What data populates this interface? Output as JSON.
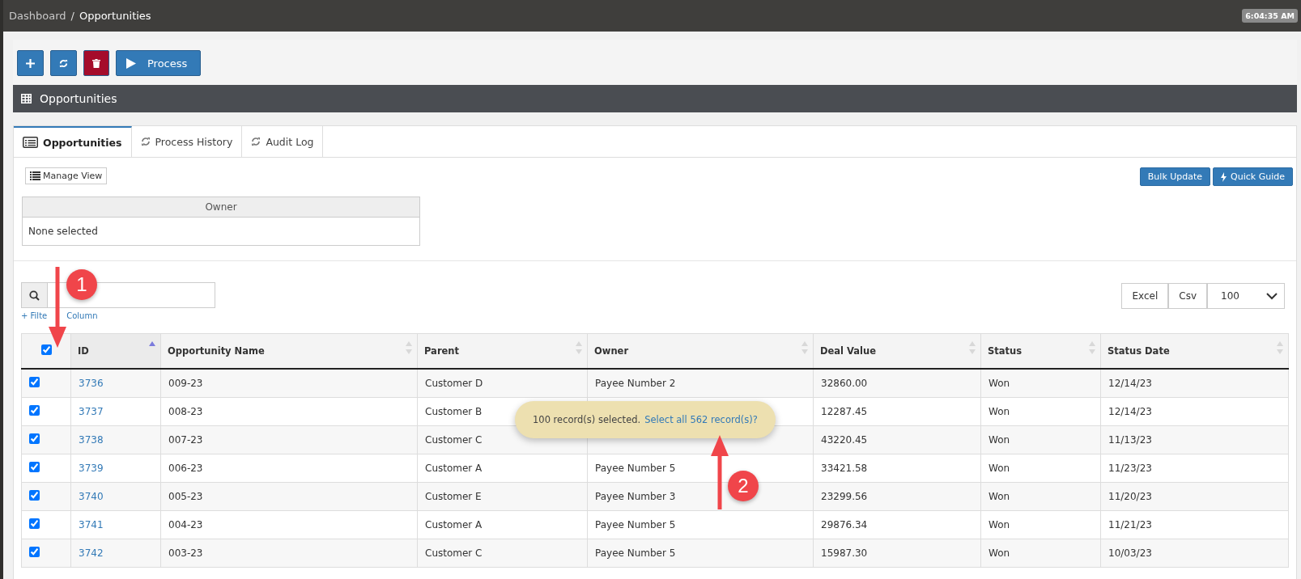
{
  "breadcrumb": [
    {
      "label": "Dashboard",
      "current": false
    },
    {
      "label": "Opportunities",
      "current": true
    }
  ],
  "breadcrumb_separator": "/",
  "clock": "6:04:35 AM",
  "toolbar": [
    {
      "kind": "add",
      "color": "#337ab7"
    },
    {
      "kind": "refresh",
      "color": "#337ab7"
    },
    {
      "kind": "delete",
      "color": "#a50c2b"
    },
    {
      "kind": "process",
      "label": "Process",
      "color": "#337ab7"
    }
  ],
  "section_title": "Opportunities",
  "tabs": [
    {
      "label": "Opportunities",
      "kind": "list",
      "selected": true
    },
    {
      "label": "Process History",
      "kind": "refresh",
      "selected": false
    },
    {
      "label": "Audit Log",
      "kind": "refresh",
      "selected": false
    }
  ],
  "manage_view": "Manage View",
  "actions": [
    {
      "label": "Bulk Update",
      "kind": "plain"
    },
    {
      "label": "Quick Guide",
      "kind": "bolt"
    }
  ],
  "owner_filter": {
    "heading": "Owner",
    "value": "None selected"
  },
  "filter_link": [
    "+ Filte",
    "Column"
  ],
  "exports": [
    "Excel",
    "Csv"
  ],
  "page_size": "100",
  "table": {
    "select_all": true,
    "columns": [
      {
        "label": "ID",
        "sorted": true
      },
      {
        "label": "Opportunity Name",
        "sorted": false
      },
      {
        "label": "Parent",
        "sorted": false
      },
      {
        "label": "Owner",
        "sorted": false
      },
      {
        "label": "Deal Value",
        "sorted": false
      },
      {
        "label": "Status",
        "sorted": false
      },
      {
        "label": "Status Date",
        "sorted": false
      }
    ],
    "rows": [
      {
        "checked": true,
        "cells": [
          "3736",
          "009-23",
          "Customer D",
          "Payee Number 2",
          "32860.00",
          "Won",
          "12/14/23"
        ]
      },
      {
        "checked": true,
        "cells": [
          "3737",
          "008-23",
          "Customer B",
          null,
          "12287.45",
          "Won",
          "12/14/23"
        ]
      },
      {
        "checked": true,
        "cells": [
          "3738",
          "007-23",
          "Customer C",
          null,
          "43220.45",
          "Won",
          "11/13/23"
        ]
      },
      {
        "checked": true,
        "cells": [
          "3739",
          "006-23",
          "Customer A",
          "Payee Number 5",
          "33421.58",
          "Won",
          "11/23/23"
        ]
      },
      {
        "checked": true,
        "cells": [
          "3740",
          "005-23",
          "Customer E",
          "Payee Number 3",
          "23299.56",
          "Won",
          "11/20/23"
        ]
      },
      {
        "checked": true,
        "cells": [
          "3741",
          "004-23",
          "Customer A",
          "Payee Number 5",
          "29876.34",
          "Won",
          "11/21/23"
        ]
      },
      {
        "checked": true,
        "cells": [
          "3742",
          "003-23",
          "Customer C",
          "Payee Number 5",
          "15987.30",
          "Won",
          "10/03/23"
        ]
      }
    ]
  },
  "selection_notice": {
    "text": "100 record(s) selected.",
    "link": "Select all 562 record(s)?"
  },
  "callouts": [
    "1",
    "2"
  ]
}
